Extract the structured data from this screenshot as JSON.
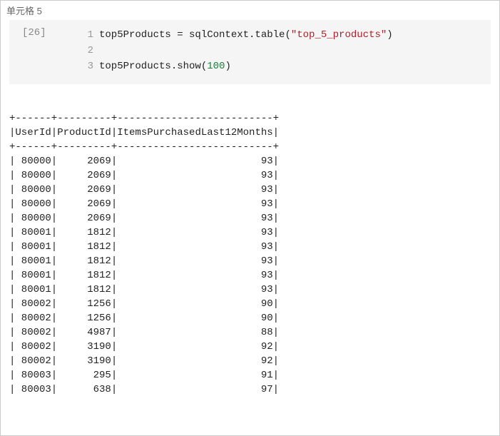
{
  "cell": {
    "label": "单元格 5",
    "prompt": "[26]",
    "lines": {
      "num1": "1",
      "num2": "2",
      "num3": "3",
      "code1_a": "top5Products = sqlContext.table(",
      "code1_str": "\"top_5_products\"",
      "code1_b": ")",
      "code2": "",
      "code3_a": "top5Products.show(",
      "code3_num": "100",
      "code3_b": ")"
    }
  },
  "output": {
    "sep": "+------+---------+--------------------------+",
    "header": "|UserId|ProductId|ItemsPurchasedLast12Months|",
    "rows": [
      "| 80000|     2069|                        93|",
      "| 80000|     2069|                        93|",
      "| 80000|     2069|                        93|",
      "| 80000|     2069|                        93|",
      "| 80000|     2069|                        93|",
      "| 80001|     1812|                        93|",
      "| 80001|     1812|                        93|",
      "| 80001|     1812|                        93|",
      "| 80001|     1812|                        93|",
      "| 80001|     1812|                        93|",
      "| 80002|     1256|                        90|",
      "| 80002|     1256|                        90|",
      "| 80002|     4987|                        88|",
      "| 80002|     3190|                        92|",
      "| 80002|     3190|                        92|",
      "| 80003|      295|                        91|",
      "| 80003|      638|                        97|"
    ]
  },
  "chart_data": {
    "type": "table",
    "title": "top5Products.show(100)",
    "columns": [
      "UserId",
      "ProductId",
      "ItemsPurchasedLast12Months"
    ],
    "rows": [
      [
        80000,
        2069,
        93
      ],
      [
        80000,
        2069,
        93
      ],
      [
        80000,
        2069,
        93
      ],
      [
        80000,
        2069,
        93
      ],
      [
        80000,
        2069,
        93
      ],
      [
        80001,
        1812,
        93
      ],
      [
        80001,
        1812,
        93
      ],
      [
        80001,
        1812,
        93
      ],
      [
        80001,
        1812,
        93
      ],
      [
        80001,
        1812,
        93
      ],
      [
        80002,
        1256,
        90
      ],
      [
        80002,
        1256,
        90
      ],
      [
        80002,
        4987,
        88
      ],
      [
        80002,
        3190,
        92
      ],
      [
        80002,
        3190,
        92
      ],
      [
        80003,
        295,
        91
      ],
      [
        80003,
        638,
        97
      ]
    ]
  }
}
